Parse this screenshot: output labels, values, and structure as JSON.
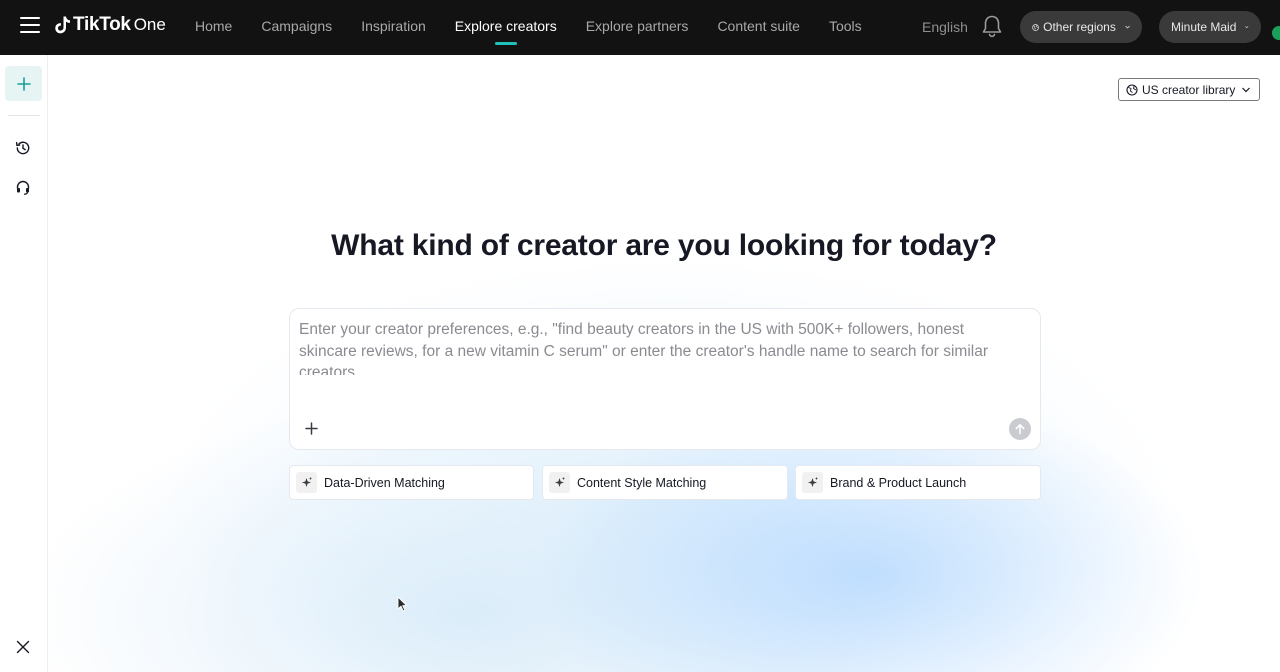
{
  "brand": {
    "name": "TikTok",
    "suffix": "One"
  },
  "nav": {
    "items": [
      {
        "label": "Home",
        "active": false
      },
      {
        "label": "Campaigns",
        "active": false
      },
      {
        "label": "Inspiration",
        "active": false
      },
      {
        "label": "Explore creators",
        "active": true
      },
      {
        "label": "Explore partners",
        "active": false
      },
      {
        "label": "Content suite",
        "active": false
      },
      {
        "label": "Tools",
        "active": false
      }
    ]
  },
  "header": {
    "language": "English",
    "region_label": "Other regions",
    "account_label": "Minute Maid"
  },
  "sidebar": {
    "icons": [
      "plus-icon",
      "history-icon",
      "headset-icon",
      "close-icon"
    ]
  },
  "main": {
    "library_label": "US creator library",
    "headline": "What kind of creator are you looking for today?",
    "prompt": {
      "value": "",
      "placeholder": "Enter your creator preferences, e.g., \"find beauty creators in the US with 500K+ followers, honest skincare reviews, for a new vitamin C serum\" or enter the creator's handle name to search for similar creators."
    },
    "chips": [
      {
        "label": "Data-Driven Matching"
      },
      {
        "label": "Content Style Matching"
      },
      {
        "label": "Brand & Product Launch"
      }
    ]
  },
  "colors": {
    "topbar_bg": "#121212",
    "accent_teal": "#21c0b8",
    "new_btn_bg": "#e6f5f4",
    "status_dot": "#19a15a"
  }
}
